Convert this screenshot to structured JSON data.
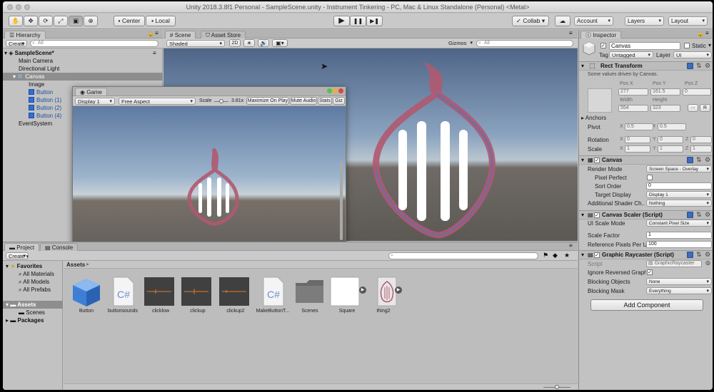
{
  "window": {
    "title": "Unity 2018.3.8f1 Personal - SampleScene.unity - Instrument Tinkering - PC, Mac & Linux Standalone (Personal) <Metal>"
  },
  "toolbar": {
    "center": "Center",
    "local": "Local",
    "collab": "Collab ▾",
    "account": "Account",
    "layers": "Layers",
    "layout": "Layout",
    "play": "▶",
    "pause": "❚❚",
    "step": "▶❚"
  },
  "hierarchy": {
    "tab": "Hierarchy",
    "create": "Create ▾",
    "search": "All",
    "scene": "SampleScene*",
    "items": [
      "Main Camera",
      "Directional Light",
      "Canvas",
      "Image",
      "Button",
      "Button (1)",
      "Button (2)",
      "Button (4)",
      "EventSystem"
    ]
  },
  "scene": {
    "tab": "Scene",
    "tab2": "Asset Store",
    "shading": "Shaded",
    "mode2d": "2D",
    "gizmos": "Gizmos",
    "search": "All"
  },
  "game": {
    "tab": "Game",
    "display": "Display 1",
    "aspect": "Free Aspect",
    "scale_label": "Scale",
    "scale_value": "3.81x",
    "maximize": "Maximize On Play",
    "mute": "Mute Audio",
    "stats": "Stats",
    "gizmos": "Giz"
  },
  "project": {
    "tab": "Project",
    "tab2": "Console",
    "create": "Create ▾",
    "favorites": {
      "label": "Favorites",
      "items": [
        "All Materials",
        "All Models",
        "All Prefabs"
      ]
    },
    "tree": {
      "assets": "Assets",
      "scenes": "Scenes",
      "packages": "Packages"
    },
    "breadcrumb": "Assets",
    "assets": [
      {
        "name": "Button",
        "kind": "cube"
      },
      {
        "name": "buttonsounds",
        "kind": "cs"
      },
      {
        "name": "clicklow",
        "kind": "audio"
      },
      {
        "name": "clickup",
        "kind": "audio"
      },
      {
        "name": "clickup2",
        "kind": "audio"
      },
      {
        "name": "MakeButtonT...",
        "kind": "cs"
      },
      {
        "name": "Scenes",
        "kind": "folder"
      },
      {
        "name": "Square",
        "kind": "sprite"
      },
      {
        "name": "thing2",
        "kind": "thing"
      }
    ]
  },
  "inspector": {
    "tab": "Inspector",
    "name": "Canvas",
    "static": "Static",
    "tag_label": "Tag",
    "tag": "Untagged",
    "layer_label": "Layer",
    "layer": "UI",
    "rect": {
      "title": "Rect Transform",
      "note": "Some values driven by Canvas.",
      "posx_label": "Pos X",
      "posy_label": "Pos Y",
      "posz_label": "Pos Z",
      "posx": "277",
      "posy": "161.5",
      "posz": "0",
      "width_label": "Width",
      "height_label": "Height",
      "width": "554",
      "height": "323",
      "r": "R",
      "anchors": "Anchors",
      "pivot": "Pivot",
      "pivot_x": "0.5",
      "pivot_y": "0.5",
      "rotation": "Rotation",
      "rot_x": "0",
      "rot_y": "0",
      "rot_z": "0",
      "scale": "Scale",
      "scale_x": "1",
      "scale_y": "1",
      "scale_z": "1",
      "x": "X",
      "y": "Y",
      "z": "Z"
    },
    "canvas": {
      "title": "Canvas",
      "render_mode_label": "Render Mode",
      "render_mode": "Screen Space - Overlay",
      "pixel_perfect": "Pixel Perfect",
      "sort_order_label": "Sort Order",
      "sort_order": "0",
      "target_display_label": "Target Display",
      "target_display": "Display 1",
      "shader_label": "Additional Shader Ch...",
      "shader": "Nothing"
    },
    "scaler": {
      "title": "Canvas Scaler (Script)",
      "mode_label": "UI Scale Mode",
      "mode": "Constant Pixel Size",
      "factor_label": "Scale Factor",
      "factor": "1",
      "ref_label": "Reference Pixels Per U",
      "ref": "100"
    },
    "raycaster": {
      "title": "Graphic Raycaster (Script)",
      "script_label": "Script",
      "script": "GraphicRaycaster",
      "ignore_label": "Ignore Reversed Graph",
      "blocking_label": "Blocking Objects",
      "blocking": "None",
      "mask_label": "Blocking Mask",
      "mask": "Everything"
    },
    "add_component": "Add Component"
  },
  "colors": {
    "accent": "#3d6cbb",
    "selection": "#8e8e8e",
    "panel": "#c2c2c2"
  }
}
